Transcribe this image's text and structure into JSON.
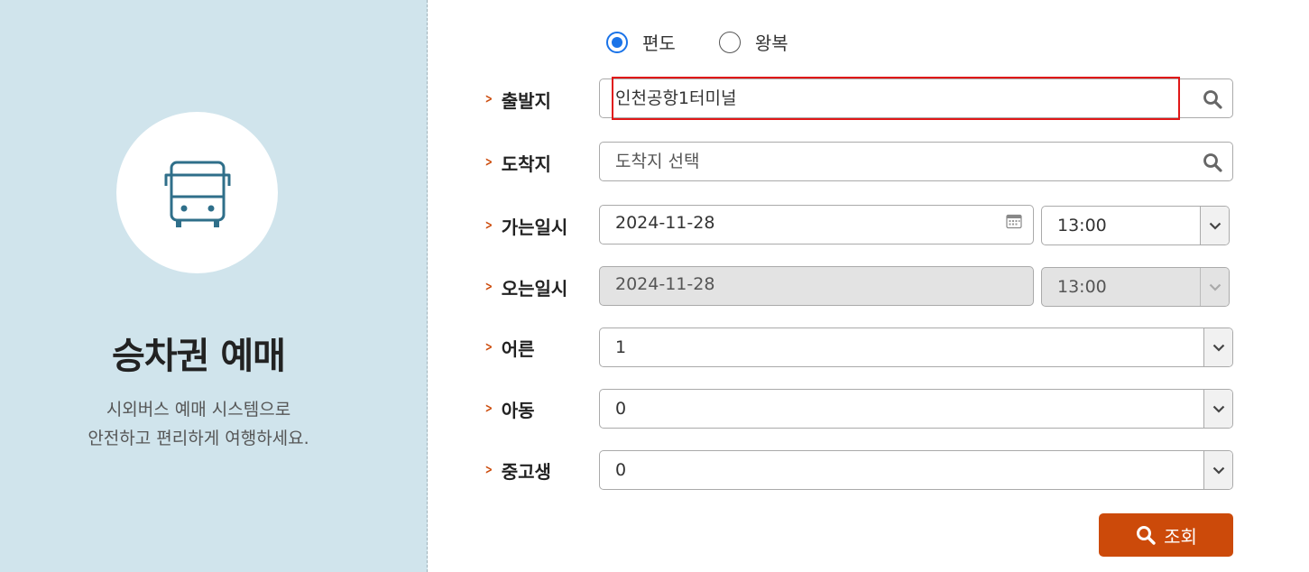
{
  "panel": {
    "title": "승차권 예매",
    "desc_line1": "시외버스 예매 시스템으로",
    "desc_line2": "안전하고 편리하게 여행하세요."
  },
  "trip_type": {
    "options": [
      {
        "label": "편도",
        "checked": true
      },
      {
        "label": "왕복",
        "checked": false
      }
    ]
  },
  "form": {
    "departure": {
      "label": "출발지",
      "value": "인천공항1터미널"
    },
    "arrival": {
      "label": "도착지",
      "placeholder": "도착지 선택"
    },
    "go_datetime": {
      "label": "가는일시",
      "date": "2024-11-28",
      "time": "13:00"
    },
    "return_datetime": {
      "label": "오는일시",
      "date": "2024-11-28",
      "time": "13:00",
      "disabled": true
    },
    "adult": {
      "label": "어른",
      "value": "1"
    },
    "child": {
      "label": "아동",
      "value": "0"
    },
    "student": {
      "label": "중고생",
      "value": "0"
    }
  },
  "search_button": {
    "label": "조회"
  },
  "colors": {
    "accent": "#cc4a0a",
    "panel_bg": "#d0e4ec",
    "radio": "#1a73e8",
    "highlight": "#e01818",
    "icon": "#2f6f8a"
  },
  "icons": [
    "bus-icon",
    "search-icon",
    "calendar-icon",
    "chevron-down-icon"
  ]
}
